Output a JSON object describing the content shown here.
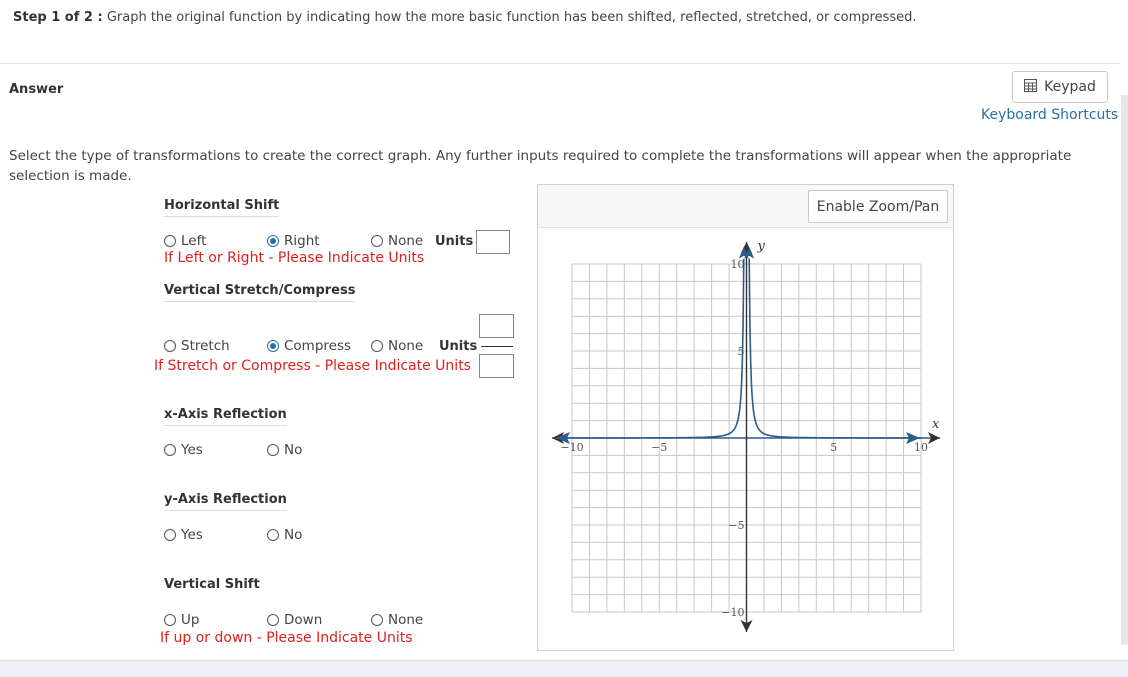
{
  "step": {
    "label": "Step 1 of 2 :",
    "text": "Graph the original function by indicating how the more basic function has been shifted, reflected, stretched, or compressed."
  },
  "answer_label": "Answer",
  "keypad_label": "Keypad",
  "shortcuts_label": "Keyboard Shortcuts",
  "instructions": "Select the type of transformations to create the correct graph. Any further inputs required to complete the transformations will appear when the appropriate selection is made.",
  "horizontal_shift": {
    "title": "Horizontal Shift",
    "options": {
      "left": "Left",
      "right": "Right",
      "none": "None"
    },
    "selected": "right",
    "units_label": "Units",
    "hint": "If Left or Right - Please Indicate Units"
  },
  "vertical_stretch": {
    "title": "Vertical Stretch/Compress",
    "options": {
      "stretch": "Stretch",
      "compress": "Compress",
      "none": "None"
    },
    "selected": "compress",
    "units_label": "Units",
    "hint": "If Stretch or Compress  - Please Indicate Units"
  },
  "x_reflection": {
    "title": "x-Axis Reflection",
    "options": {
      "yes": "Yes",
      "no": "No"
    }
  },
  "y_reflection": {
    "title": "y-Axis Reflection",
    "options": {
      "yes": "Yes",
      "no": "No"
    }
  },
  "vertical_shift": {
    "title": "Vertical Shift",
    "options": {
      "up": "Up",
      "down": "Down",
      "none": "None"
    },
    "hint": "If up or down  - Please Indicate Units"
  },
  "graph": {
    "zoom_label": "Enable Zoom/Pan",
    "x_axis_label": "x",
    "y_axis_label": "y",
    "x_ticks": [
      "−10",
      "−5",
      "5",
      "10"
    ],
    "y_ticks": [
      "10",
      "5",
      "−5",
      "−10"
    ],
    "curve_color": "#2b5c8a",
    "axis_color": "#2b5c8a"
  }
}
